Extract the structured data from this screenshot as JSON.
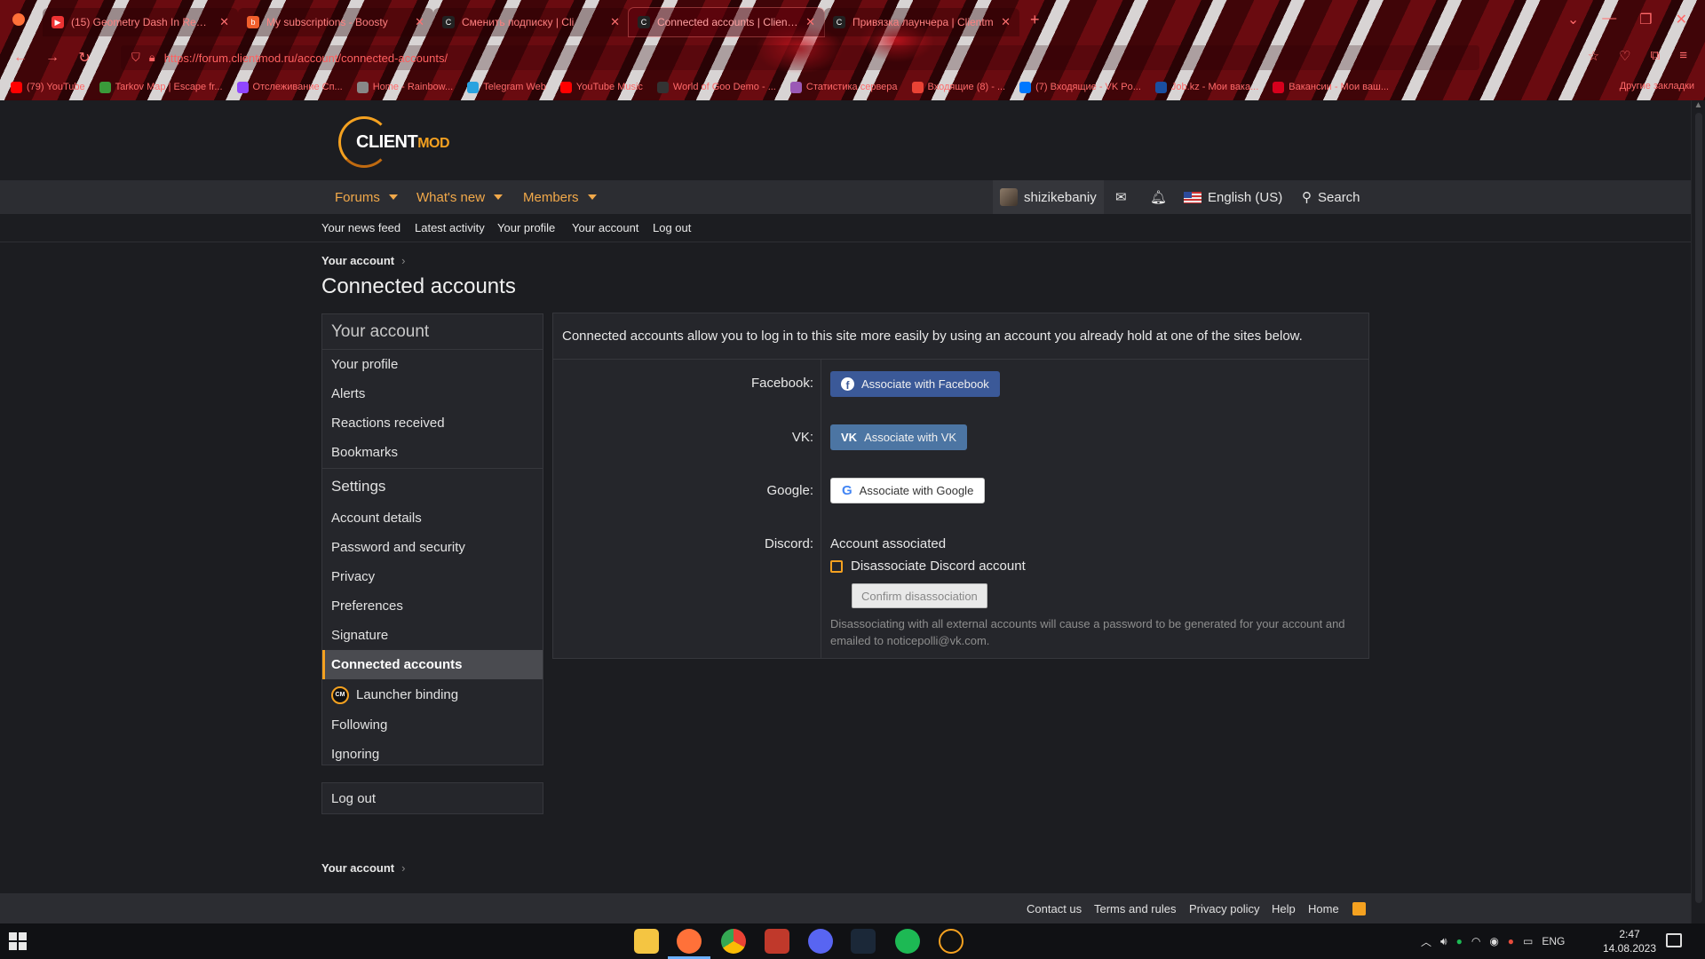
{
  "browser": {
    "tabs": [
      {
        "title": "(15) Geometry Dash In Real Ar",
        "favicon_color": "#ff0000",
        "active": false
      },
      {
        "title": "My subscriptions - Boosty",
        "favicon_color": "#f15f2c",
        "active": false
      },
      {
        "title": "Сменить подписку | Cli",
        "favicon_color": "#222222",
        "active": false
      },
      {
        "title": "Connected accounts | Clientm",
        "favicon_color": "#222222",
        "active": true
      },
      {
        "title": "Привязка лаунчера | Clientm",
        "favicon_color": "#222222",
        "active": false
      }
    ],
    "url": "https://forum.clientmod.ru/account/connected-accounts/",
    "bookmarks": [
      {
        "label": "(79) YouTube",
        "color": "#ff0000"
      },
      {
        "label": "Tarkov Map | Escape fr...",
        "color": "#3a9a3a"
      },
      {
        "label": "Отслеживание Сп...",
        "color": "#9146ff"
      },
      {
        "label": "Home - Rainbow...",
        "color": "#888888"
      },
      {
        "label": "Telegram Web",
        "color": "#2aa3e0"
      },
      {
        "label": "YouTube Music",
        "color": "#ff0000"
      },
      {
        "label": "World of Goo Demo - ...",
        "color": "#333333"
      },
      {
        "label": "Статистика сервера",
        "color": "#9b59b6"
      },
      {
        "label": "Входящие (8) - ...",
        "color": "#ea4335"
      },
      {
        "label": "(7) Входящие - VK Po...",
        "color": "#0077ff"
      },
      {
        "label": "Job.kz - Мои вака...",
        "color": "#1a4fa0"
      },
      {
        "label": "Вакансии - Мои ваш...",
        "color": "#d6001c"
      }
    ],
    "bookmarks_other": "Другие закладки"
  },
  "site": {
    "logo_main": "CLIENT",
    "logo_accent": "MOD",
    "nav": {
      "forums": "Forums",
      "whats_new": "What's new",
      "members": "Members",
      "username": "shizikebaniy",
      "language": "English (US)",
      "search": "Search"
    },
    "subnav": [
      "Your news feed",
      "Latest activity",
      "Your profile",
      "Your account",
      "Log out"
    ],
    "breadcrumb": "Your account",
    "page_title": "Connected accounts",
    "sidebar": {
      "heading": "Your account",
      "group1": [
        "Your profile",
        "Alerts",
        "Reactions received",
        "Bookmarks"
      ],
      "settings_heading": "Settings",
      "group2": [
        "Account details",
        "Password and security",
        "Privacy",
        "Preferences",
        "Signature",
        "Connected accounts",
        "Launcher binding",
        "Following",
        "Ignoring"
      ],
      "active": "Connected accounts",
      "logout": "Log out"
    },
    "panel": {
      "intro": "Connected accounts allow you to log in to this site more easily by using an account you already hold at one of the sites below.",
      "facebook_label": "Facebook:",
      "facebook_btn": "Associate with Facebook",
      "vk_label": "VK:",
      "vk_btn": "Associate with VK",
      "google_label": "Google:",
      "google_btn": "Associate with Google",
      "discord_label": "Discord:",
      "discord_status": "Account associated",
      "discord_checkbox": "Disassociate Discord account",
      "discord_confirm": "Confirm disassociation",
      "discord_hint": "Disassociating with all external accounts will cause a password to be generated for your account and emailed to noticepolli@vk.com."
    },
    "footer": [
      "Contact us",
      "Terms and rules",
      "Privacy policy",
      "Help",
      "Home"
    ]
  },
  "taskbar": {
    "lang": "ENG",
    "time": "2:47",
    "date": "14.08.2023"
  },
  "colors": {
    "accent": "#f4a120",
    "link": "#f2a94a",
    "bg": "#1c1d21",
    "panel": "#25262b"
  }
}
